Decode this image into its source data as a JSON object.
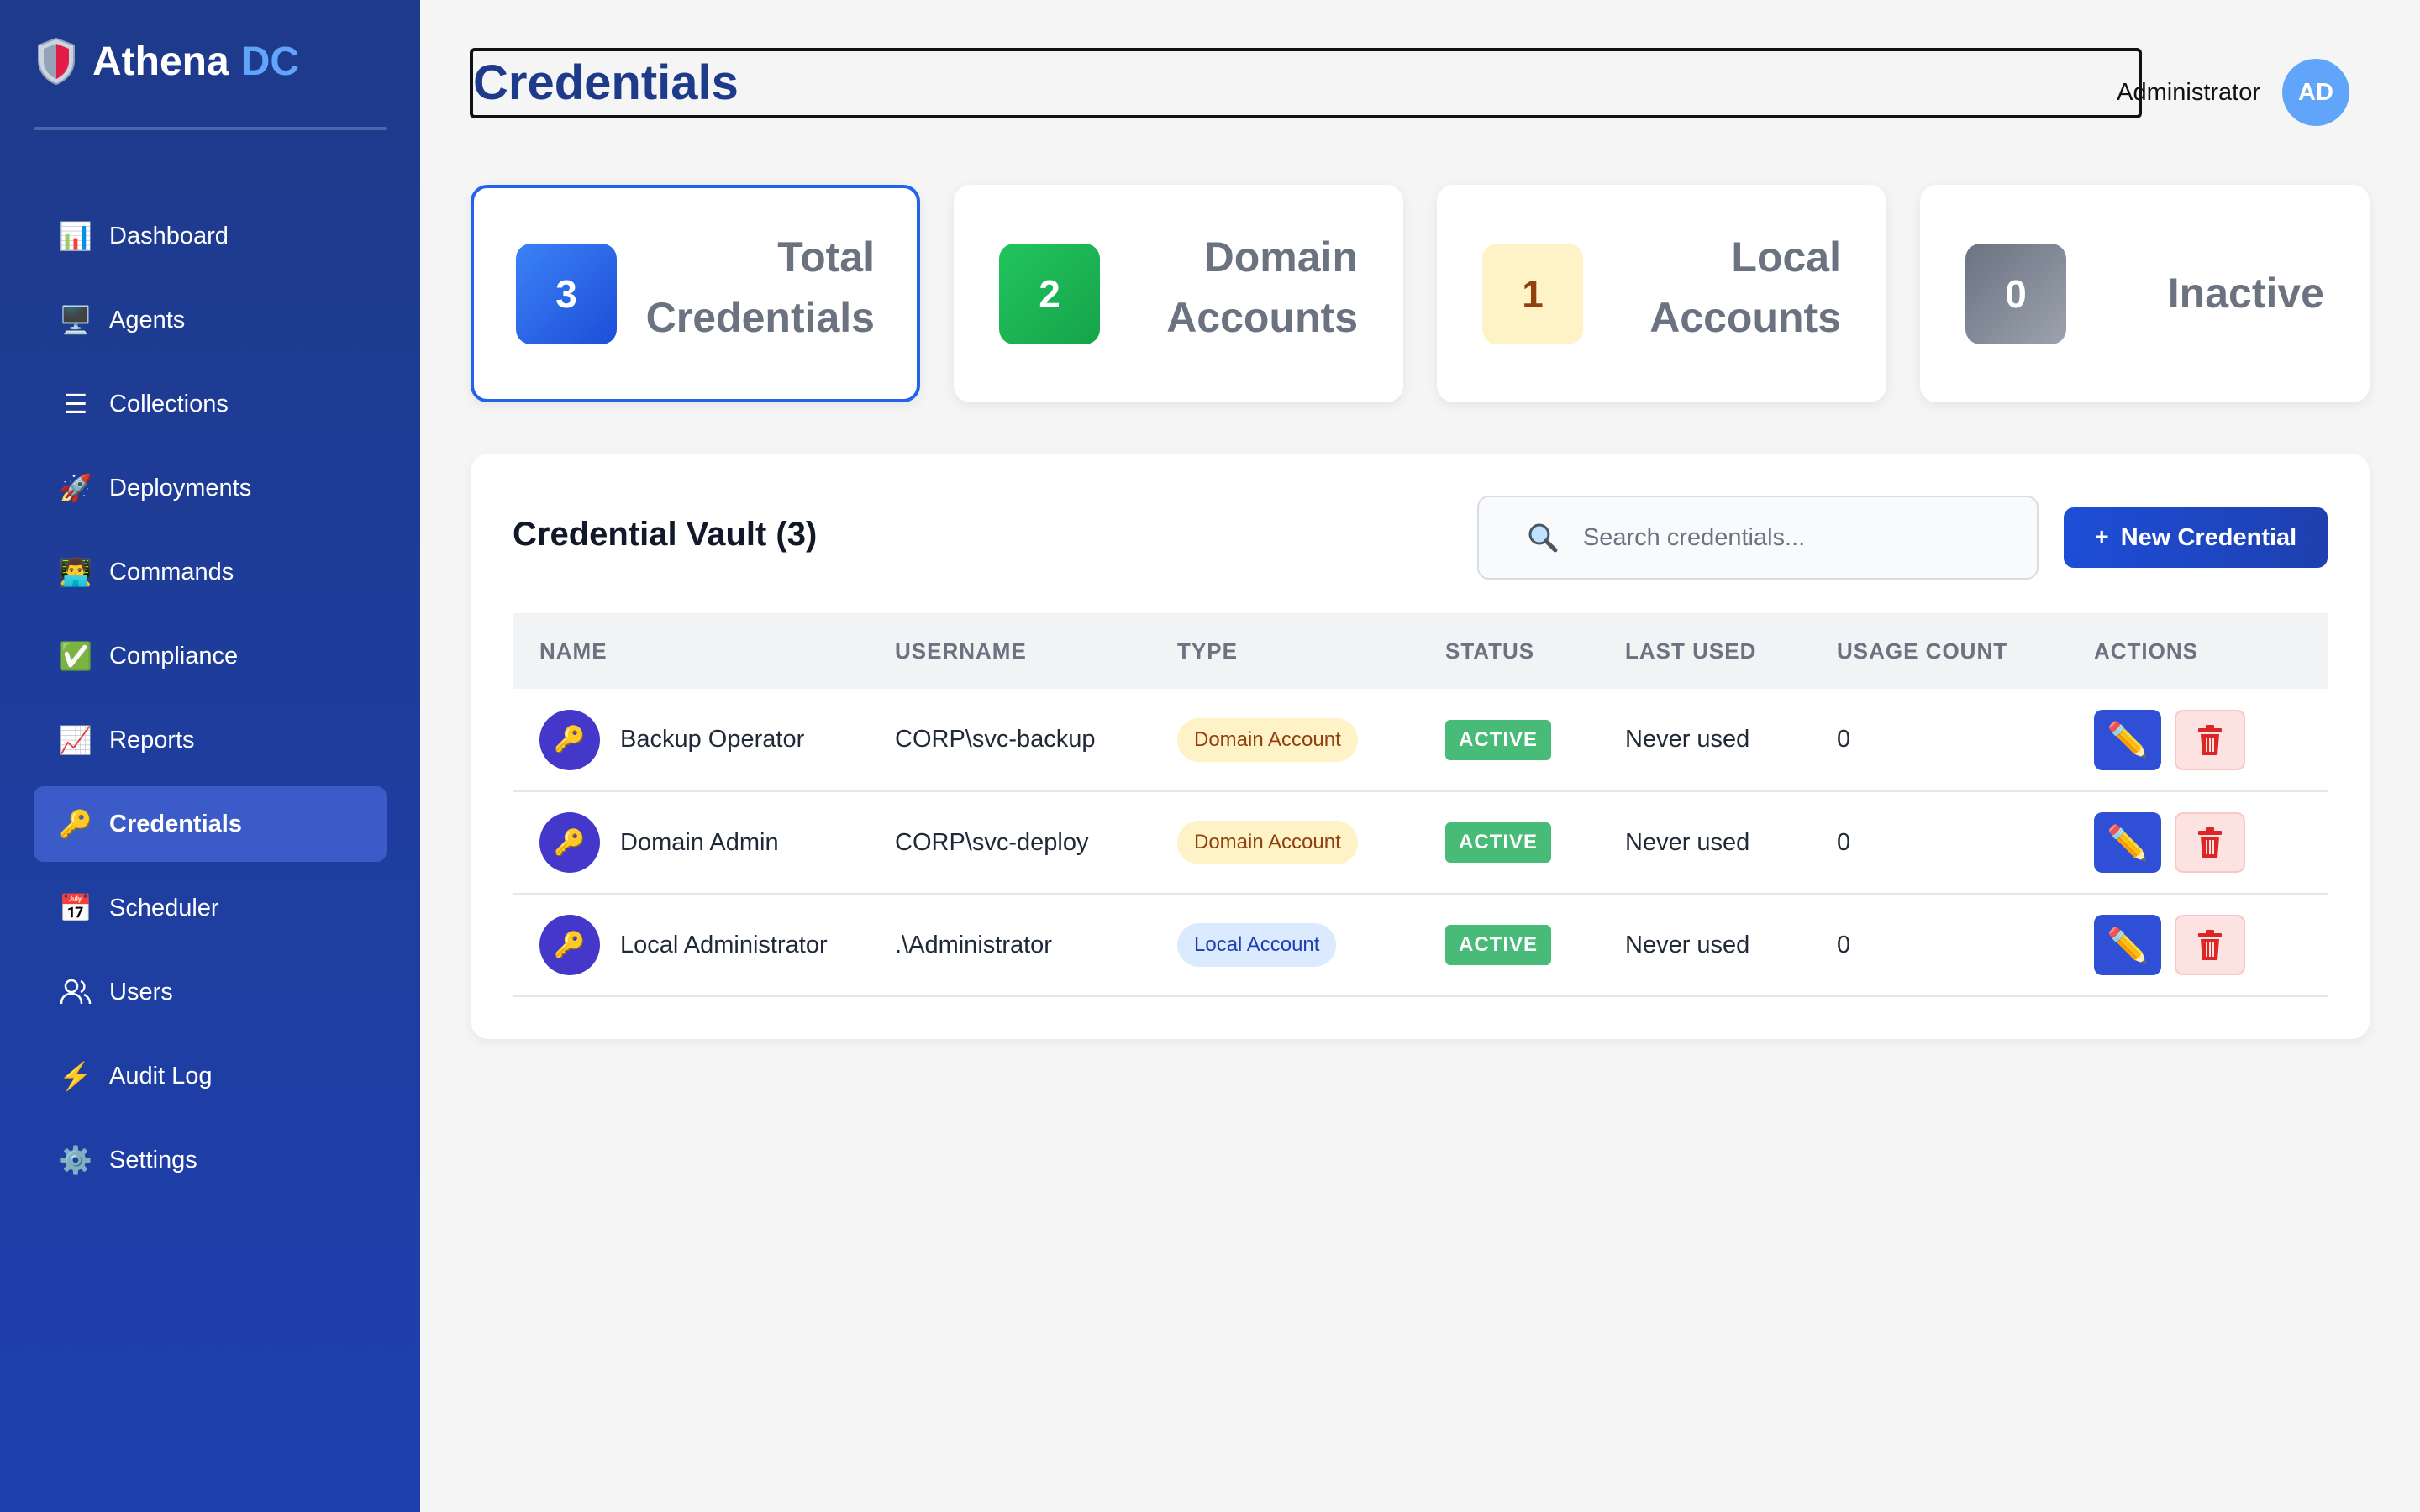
{
  "sidebar": {
    "brand_name": "Athena",
    "brand_accent": "DC",
    "brand_icon": "shield-icon",
    "items": [
      {
        "label": "Dashboard",
        "icon": "📊"
      },
      {
        "label": "Agents",
        "icon": "🖥️"
      },
      {
        "label": "Collections",
        "icon": "☰"
      },
      {
        "label": "Deployments",
        "icon": "🚀"
      },
      {
        "label": "Commands",
        "icon": "👨‍💻"
      },
      {
        "label": "Compliance",
        "icon": "✅"
      },
      {
        "label": "Reports",
        "icon": "📈"
      },
      {
        "label": "Credentials",
        "icon": "🔑",
        "active": true
      },
      {
        "label": "Scheduler",
        "icon": "📅"
      },
      {
        "label": "Users",
        "icon": "users-icon"
      },
      {
        "label": "Audit Log",
        "icon": "⚡"
      },
      {
        "label": "Settings",
        "icon": "⚙️"
      }
    ]
  },
  "header": {
    "title": "Credentials",
    "user_name": "Administrator",
    "avatar_initials": "AD"
  },
  "stats": [
    {
      "value": "3",
      "label": "Total Credentials",
      "color": "#2563eb"
    },
    {
      "value": "2",
      "label": "Domain Accounts",
      "color": "#16a34a"
    },
    {
      "value": "1",
      "label": "Local Accounts",
      "color": "#fef3c7",
      "text_color": "#92400e"
    },
    {
      "value": "0",
      "label": "Inactive",
      "color": "#6b7280"
    }
  ],
  "vault": {
    "title": "Credential Vault (3)",
    "search_placeholder": "Search credentials...",
    "new_button": "New Credential",
    "columns": [
      "NAME",
      "USERNAME",
      "TYPE",
      "STATUS",
      "LAST USED",
      "USAGE COUNT",
      "ACTIONS"
    ],
    "rows": [
      {
        "name": "Backup Operator",
        "username": "CORP\\svc-backup",
        "type": "Domain Account",
        "status": "ACTIVE",
        "last_used": "Never used",
        "usage_count": "0"
      },
      {
        "name": "Domain Admin",
        "username": "CORP\\svc-deploy",
        "type": "Domain Account",
        "status": "ACTIVE",
        "last_used": "Never used",
        "usage_count": "0"
      },
      {
        "name": "Local Administrator",
        "username": ".\\Administrator",
        "type": "Local Account",
        "status": "ACTIVE",
        "last_used": "Never used",
        "usage_count": "0"
      }
    ]
  }
}
